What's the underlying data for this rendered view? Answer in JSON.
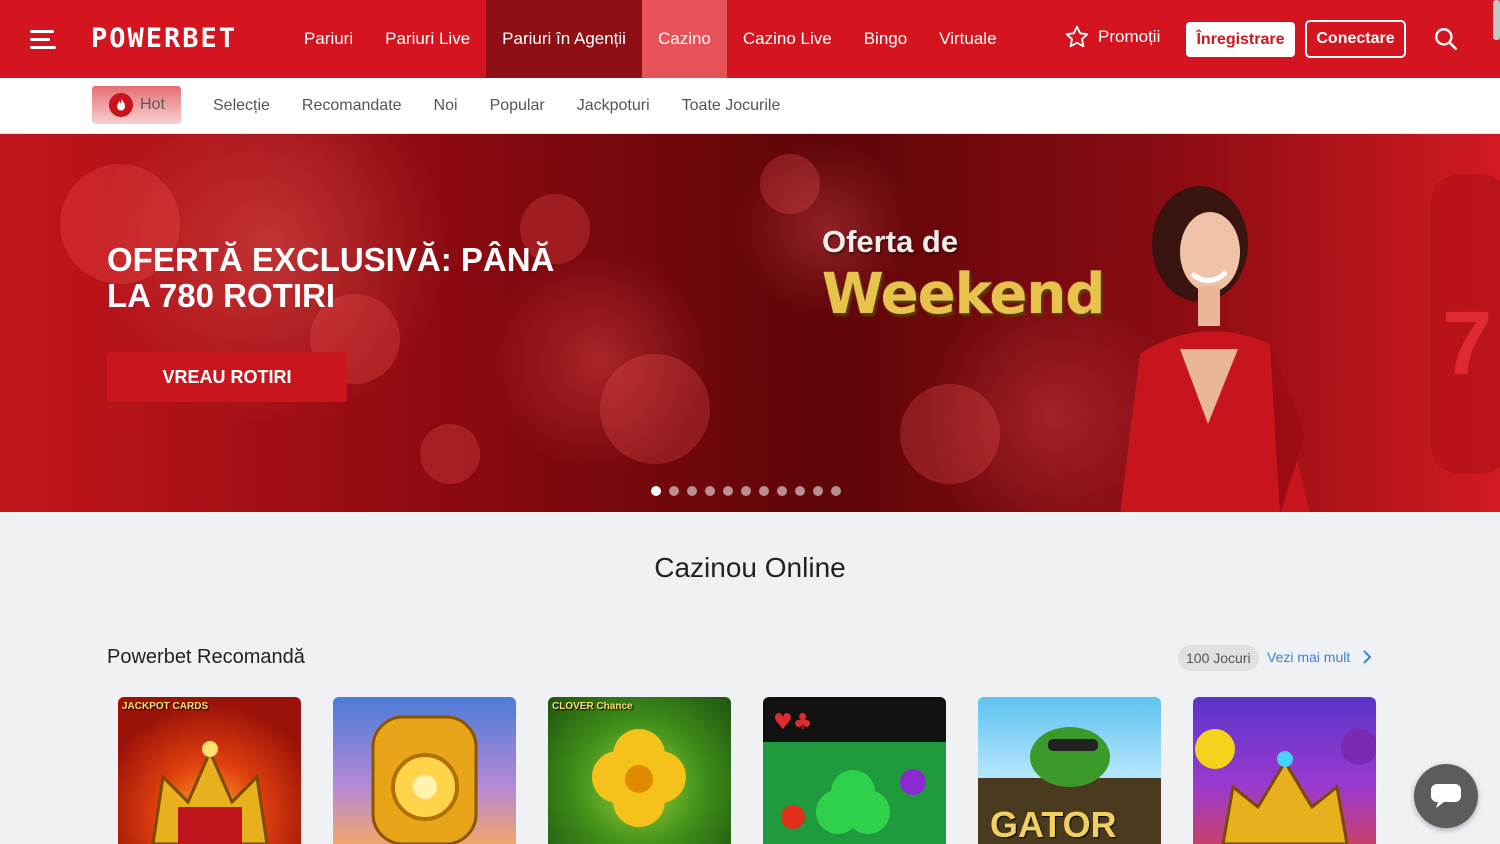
{
  "header": {
    "logo": "POWERBET",
    "nav": [
      {
        "label": "Pariuri"
      },
      {
        "label": "Pariuri Live"
      },
      {
        "label": "Pariuri în Agenții"
      },
      {
        "label": "Cazino"
      },
      {
        "label": "Cazino Live"
      },
      {
        "label": "Bingo"
      },
      {
        "label": "Virtuale"
      }
    ],
    "active_nav": "Cazino",
    "promo_label": "Promoții",
    "register_label": "Înregistrare",
    "login_label": "Conectare",
    "brand_color": "#d4151f"
  },
  "subnav": {
    "hot_label": "Hot",
    "items": [
      "Selecție",
      "Recomandate",
      "Noi",
      "Popular",
      "Jackpoturi",
      "Toate Jocurile"
    ]
  },
  "hero": {
    "title": "OFERTĂ EXCLUSIVĂ: PÂNĂ LA 780 ROTIRI",
    "button_label": "VREAU ROTIRI",
    "offer_line1": "Oferta de",
    "offer_line2": "Weekend",
    "slide_count": 11,
    "active_slide": 1
  },
  "section": {
    "title": "Cazinou Online",
    "row_title": "Powerbet Recomandă",
    "count_badge": "100 Jocuri",
    "see_more": "Vezi mai mult"
  },
  "games": [
    {
      "caption": "JACKPOT CARDS",
      "theme": "crown-red"
    },
    {
      "caption": "",
      "theme": "gold-train"
    },
    {
      "caption": "CLOVER Chance",
      "theme": "clover-green"
    },
    {
      "caption": "",
      "theme": "cards-clover"
    },
    {
      "caption": "GATOR",
      "theme": "gator"
    },
    {
      "caption": "",
      "theme": "crown-purple"
    }
  ]
}
